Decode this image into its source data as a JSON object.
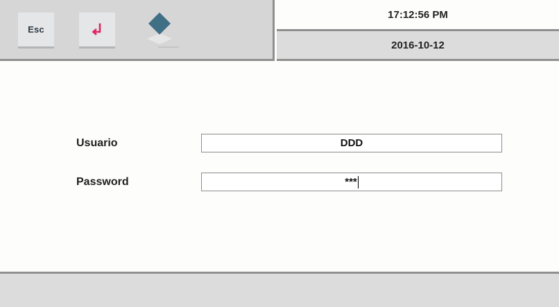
{
  "toolbar": {
    "esc_label": "Esc",
    "enter_icon": "enter-arrow-icon",
    "diamond_icon": "diamond-icon",
    "colors": {
      "enter_arrow": "#e0245e",
      "diamond": "#3f6f85"
    }
  },
  "clock": {
    "time": "17:12:56 PM",
    "date": "2016-10-12"
  },
  "login": {
    "user_label": "Usuario",
    "user_value": "DDD",
    "password_label": "Password",
    "password_value": "***"
  }
}
